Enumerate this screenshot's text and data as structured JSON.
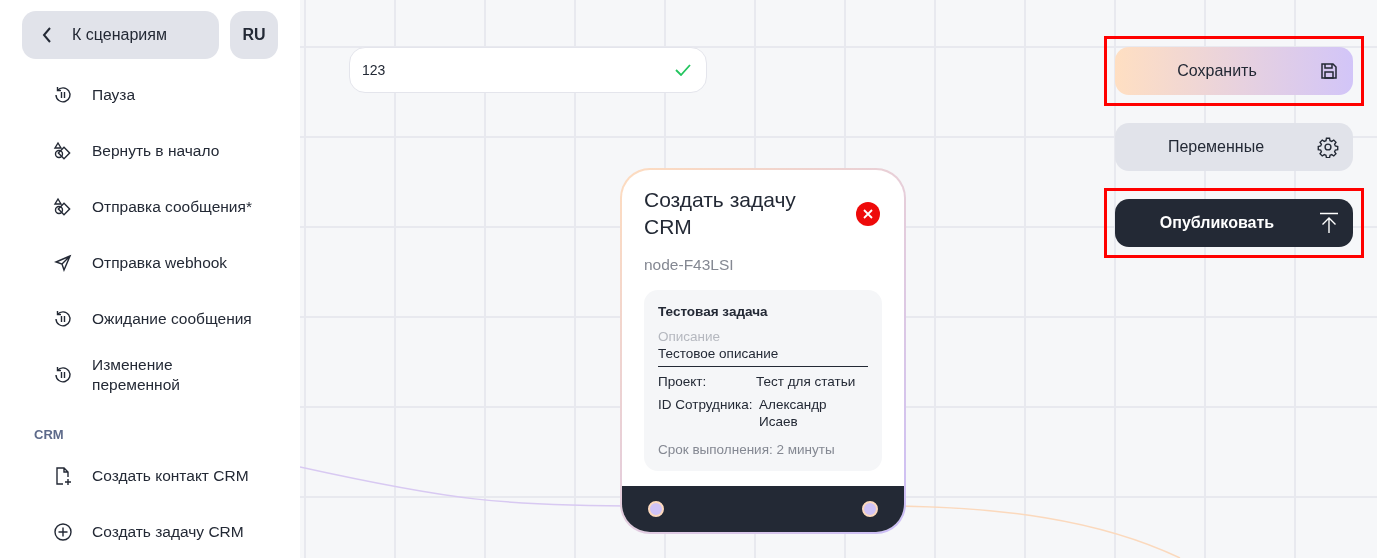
{
  "back_button": {
    "label": "К сценариям"
  },
  "language_button": {
    "label": "RU"
  },
  "sidebar": {
    "groups": [
      {
        "items": [
          {
            "label": "Пауза",
            "kind": "history"
          },
          {
            "label": "Вернуть в начало",
            "kind": "shapes"
          },
          {
            "label": "Отправка сообщения*",
            "kind": "shapes"
          },
          {
            "label": "Отправка webhook",
            "kind": "send"
          },
          {
            "label": "Ожидание сообщения",
            "kind": "history"
          },
          {
            "label": "Изменение переменной",
            "kind": "history"
          }
        ]
      },
      {
        "title": "CRM",
        "items": [
          {
            "label": "Создать контакт CRM",
            "kind": "file-plus"
          },
          {
            "label": "Создать задачу CRM",
            "kind": "plus-circle"
          }
        ]
      }
    ]
  },
  "name_field": {
    "value": "123",
    "valid": true
  },
  "node": {
    "title": "Создать задачу CRM",
    "id": "node-F43LSI",
    "task": {
      "title": "Тестовая задача",
      "description_label": "Описание",
      "description": "Тестовое описание",
      "fields": [
        {
          "label": "Проект:",
          "value": "Тест для статьи"
        },
        {
          "label": "ID Сотрудника:",
          "value": "Александр Исаев"
        }
      ],
      "deadline": "Срок выполнения: 2 минуты"
    }
  },
  "actions": [
    {
      "label": "Сохранить",
      "kind": "save",
      "highlighted": true
    },
    {
      "label": "Переменные",
      "kind": "settings",
      "highlighted": false
    },
    {
      "label": "Опубликовать",
      "kind": "publish",
      "highlighted": true
    }
  ]
}
